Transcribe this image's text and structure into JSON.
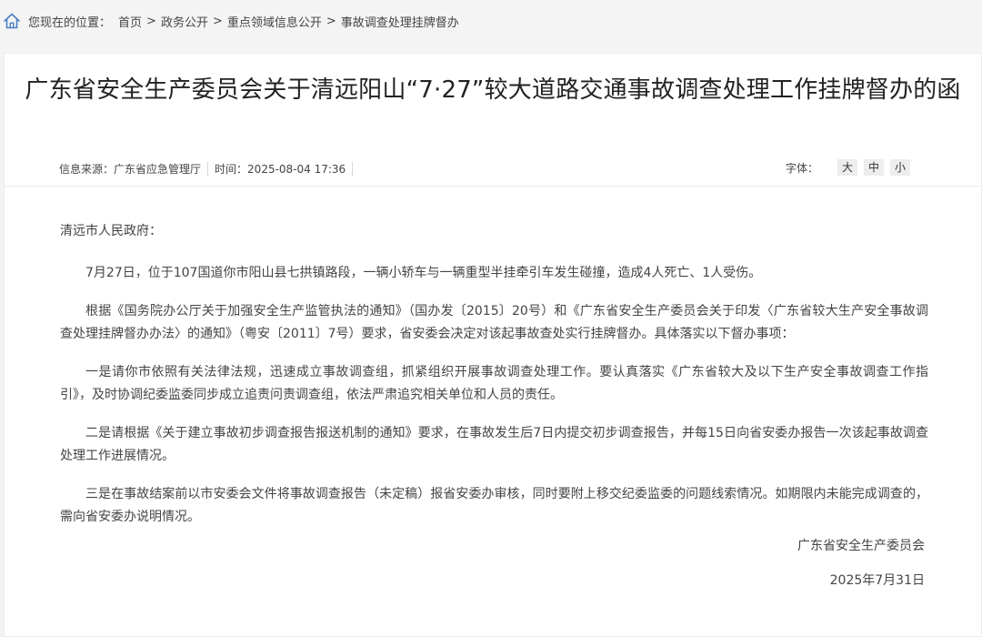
{
  "breadcrumb": {
    "prefix": "您现在的位置：",
    "items": [
      "首页",
      "政务公开",
      "重点领域信息公开",
      "事故调查处理挂牌督办"
    ],
    "separator": ">"
  },
  "article": {
    "title": "广东省安全生产委员会关于清远阳山“7·27”较大道路交通事故调查处理工作挂牌督办的函",
    "source_label": "信息来源：",
    "source": "广东省应急管理厅",
    "time_label": "时间：",
    "time": "2025-08-04 17:36",
    "font_label": "字体：",
    "font_sizes": [
      "大",
      "中",
      "小"
    ],
    "salutation": "清远市人民政府：",
    "paragraphs": [
      "7月27日，位于107国道你市阳山县七拱镇路段，一辆小轿车与一辆重型半挂牵引车发生碰撞，造成4人死亡、1人受伤。",
      "根据《国务院办公厅关于加强安全生产监管执法的通知》（国办发〔2015〕20号）和《广东省安全生产委员会关于印发〈广东省较大生产安全事故调查处理挂牌督办办法〉的通知》（粤安〔2011〕7号）要求，省安委会决定对该起事故查处实行挂牌督办。具体落实以下督办事项：",
      "一是请你市依照有关法律法规，迅速成立事故调查组，抓紧组织开展事故调查处理工作。要认真落实《广东省较大及以下生产安全事故调查工作指引》，及时协调纪委监委同步成立追责问责调查组，依法严肃追究相关单位和人员的责任。",
      "二是请根据《关于建立事故初步调查报告报送机制的通知》要求，在事故发生后7日内提交初步调查报告，并每15日向省安委办报告一次该起事故调查处理工作进展情况。",
      "三是在事故结案前以市安委会文件将事故调查报告（未定稿）报省安委办审核，同时要附上移交纪委监委的问题线索情况。如期限内未能完成调查的，需向省安委办说明情况。"
    ],
    "signer": "广东省安全生产委员会",
    "date": "2025年7月31日"
  },
  "icons": {
    "home": "home-icon"
  },
  "colors": {
    "page_background": "#f4f4f4",
    "card_background": "#ffffff",
    "icon": "#4a7fc1",
    "font_button_background": "#ededed"
  }
}
